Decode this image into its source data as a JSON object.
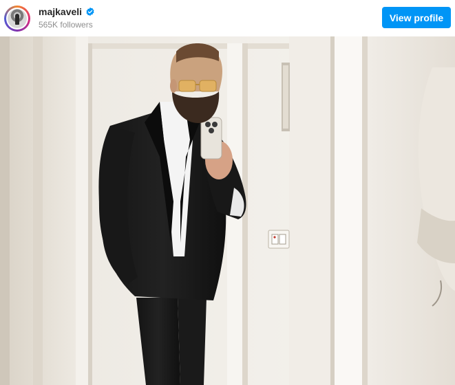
{
  "header": {
    "username": "majkaveli",
    "followers": "565K followers",
    "view_profile_label": "View profile"
  },
  "icons": {
    "verified": "verified-badge-icon",
    "avatar": "profile-avatar"
  },
  "colors": {
    "accent": "#0095f6",
    "username": "#262626",
    "secondary_text": "#8e8e8e"
  },
  "photo": {
    "subject": "man in black suit taking mirror selfie"
  }
}
